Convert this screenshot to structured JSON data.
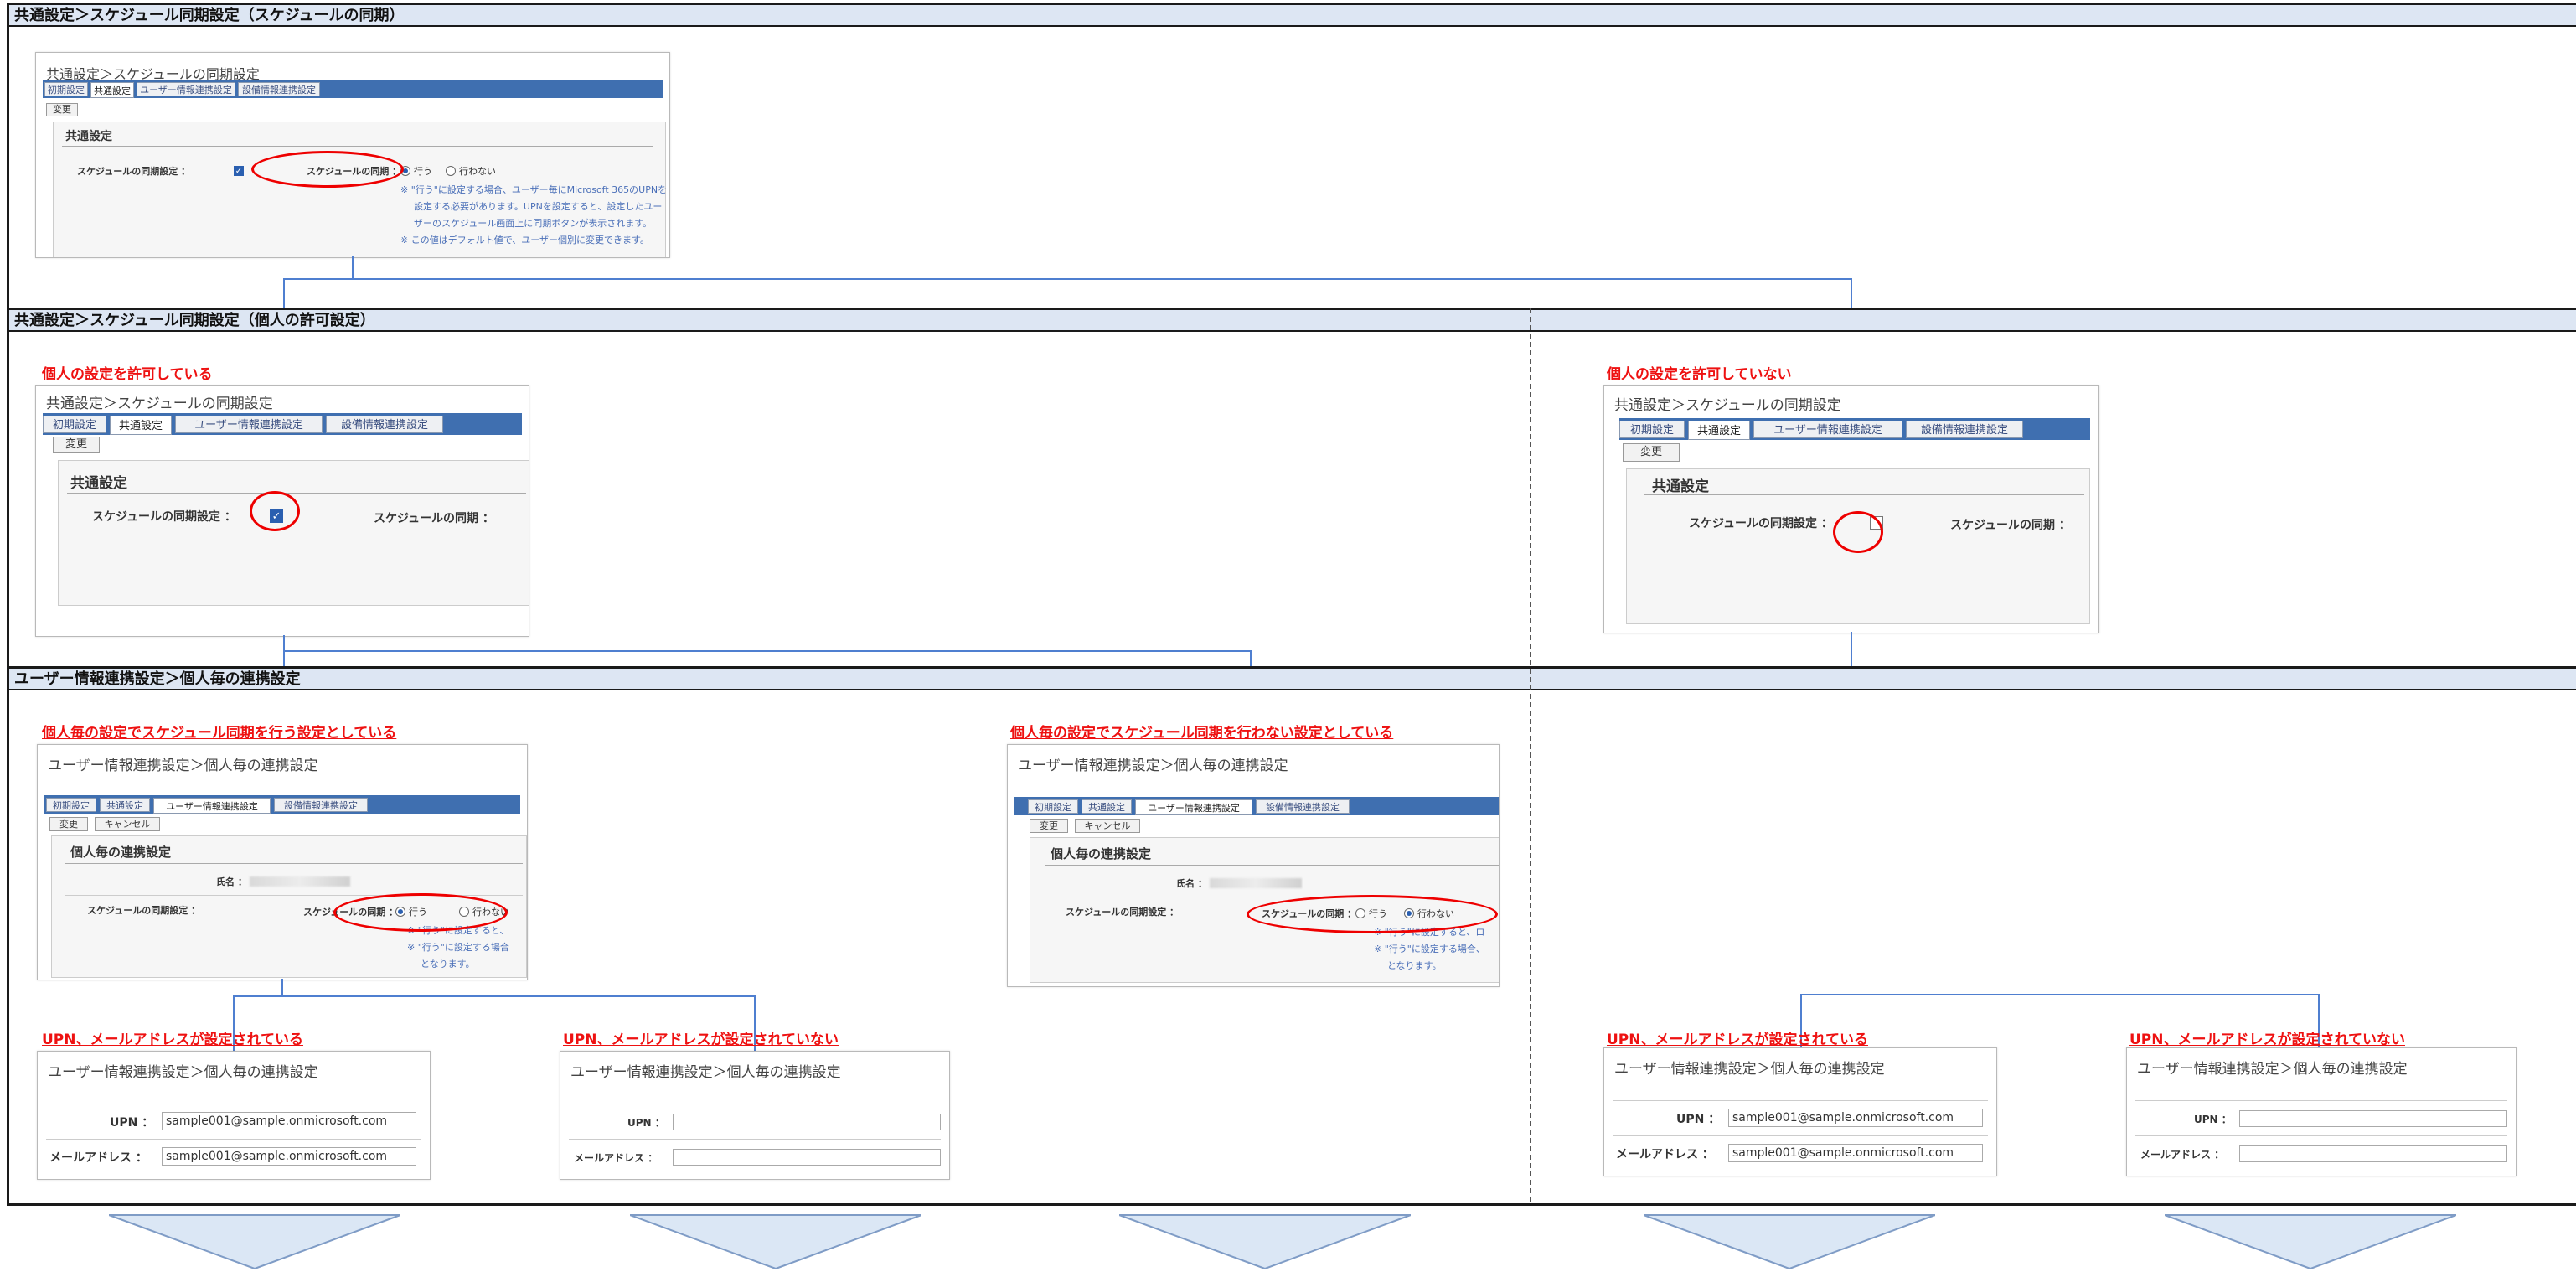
{
  "sections": {
    "s1": "共通設定＞スケジュール同期設定（スケジュールの同期）",
    "s2": "共通設定＞スケジュール同期設定（個人の許可設定）",
    "s3": "ユーザー情報連携設定＞個人毎の連携設定"
  },
  "red_titles": {
    "allowed": "個人の設定を許可している",
    "not_allowed": "個人の設定を許可していない",
    "sync_do": "個人毎の設定でスケジュール同期を行う設定としている",
    "sync_dont": "個人毎の設定でスケジュール同期を行わない設定としている",
    "upn_set": "UPN、メールアドレスが設定されている",
    "upn_unset": "UPN、メールアドレスが設定されていない"
  },
  "common": {
    "panel_title": "共通設定＞スケジュールの同期設定",
    "tabs": [
      "初期設定",
      "共通設定",
      "ユーザー情報連携設定",
      "設備情報連携設定"
    ],
    "change_button": "変更",
    "cancel_button": "キャンセル",
    "legend": "共通設定",
    "sync_setting_label": "スケジュールの同期設定 ：",
    "sync_label": "スケジュールの同期 ：",
    "radio_do": "行う",
    "radio_dont": "行わない",
    "notes": [
      "※ \"行う\"に設定する場合、ユーザー毎にMicrosoft 365のUPNを",
      "設定する必要があります。UPNを設定すると、設定したユー",
      "ザーのスケジュール画面上に同期ボタンが表示されます。",
      "※ この値はデフォルト値で、ユーザー個別に変更できます。"
    ]
  },
  "personal": {
    "panel_title": "ユーザー情報連携設定＞個人毎の連携設定",
    "legend": "個人毎の連携設定",
    "name_label": "氏名 ：",
    "sync_setting_label": "スケジュールの同期設定 ：",
    "sync_label": "スケジュールの同期 ：",
    "radio_do": "行う",
    "radio_dont": "行わない",
    "notes_a": [
      "※ \"行う\"に設定すると、",
      "※ \"行う\"に設定する場合",
      "となります。"
    ],
    "notes_b": [
      "※ \"行う\"に設定すると、ロ",
      "※ \"行う\"に設定する場合、",
      "となります。"
    ]
  },
  "upn": {
    "panel_title": "ユーザー情報連携設定＞個人毎の連携設定",
    "upn_label": "UPN ：",
    "mail_label": "メールアドレス ：",
    "sample_value": "sample001@sample.onmicrosoft.com"
  },
  "colors": {
    "accent_red": "#ee1111",
    "tab_blue": "#3f6fb0",
    "section_header": "#dde6f3",
    "arrow_fill": "#dbe7f5",
    "connector": "#4f7fd0"
  }
}
